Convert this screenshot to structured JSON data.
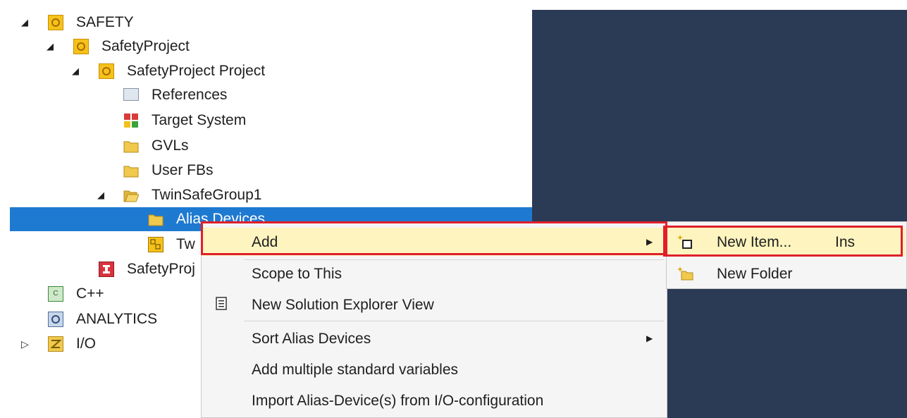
{
  "tree": {
    "items": [
      {
        "label": "SAFETY",
        "icon": "safety-gear-icon"
      },
      {
        "label": "SafetyProject",
        "icon": "safety-gear-icon"
      },
      {
        "label": "SafetyProject Project",
        "icon": "safety-gear-icon"
      },
      {
        "label": "References",
        "icon": "references-icon"
      },
      {
        "label": "Target System",
        "icon": "target-system-icon"
      },
      {
        "label": "GVLs",
        "icon": "folder-icon"
      },
      {
        "label": "User FBs",
        "icon": "folder-icon"
      },
      {
        "label": "TwinSafeGroup1",
        "icon": "folder-open-icon"
      },
      {
        "label": "Alias Devices",
        "icon": "folder-icon"
      },
      {
        "label": "Tw",
        "icon": "group-icon"
      },
      {
        "label": "SafetyProj",
        "icon": "safety-doc-icon"
      },
      {
        "label": "C++",
        "icon": "cpp-icon"
      },
      {
        "label": "ANALYTICS",
        "icon": "analytics-icon"
      },
      {
        "label": "I/O",
        "icon": "io-icon"
      }
    ]
  },
  "context_menu": {
    "items": [
      {
        "label": "Add",
        "has_submenu": true
      },
      {
        "label": "Scope to This"
      },
      {
        "label": "New Solution Explorer View",
        "icon": "solution-explorer-icon"
      },
      {
        "label": "Sort Alias Devices",
        "has_submenu": true
      },
      {
        "label": "Add multiple standard variables"
      },
      {
        "label": "Import Alias-Device(s) from I/O-configuration"
      }
    ]
  },
  "submenu": {
    "items": [
      {
        "label": "New Item...",
        "shortcut": "Ins",
        "icon": "new-item-icon"
      },
      {
        "label": "New Folder",
        "icon": "new-folder-icon"
      }
    ]
  },
  "colors": {
    "selection": "#1e7ad1",
    "highlight_border": "#e01f2b",
    "menu_hover": "#fdf4bf",
    "dark_panel": "#2b3a55"
  }
}
